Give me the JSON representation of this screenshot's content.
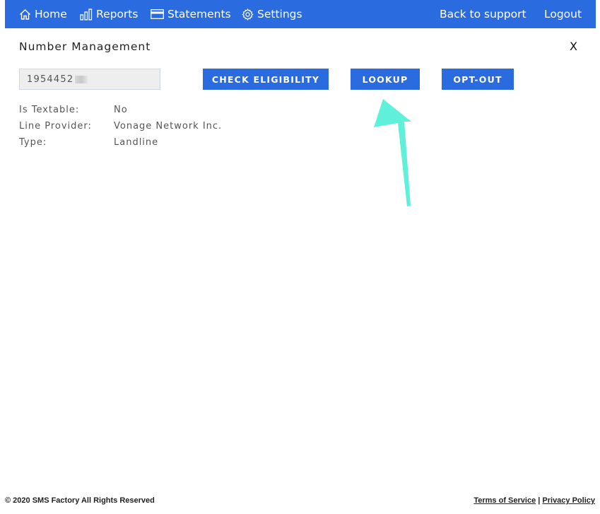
{
  "nav": {
    "home": {
      "label": "Home",
      "icon": "home-icon"
    },
    "reports": {
      "label": "Reports",
      "icon": "bar-chart-icon"
    },
    "statements": {
      "label": "Statements",
      "icon": "statement-icon"
    },
    "settings": {
      "label": "Settings",
      "icon": "gear-icon"
    },
    "back_to_support": "Back to support",
    "logout": "Logout"
  },
  "panel": {
    "title": "Number Management",
    "close_label": "X",
    "number_value": "1954452",
    "buttons": {
      "check_eligibility": "CHECK ELIGIBILITY",
      "lookup": "LOOKUP",
      "opt_out": "OPT-OUT"
    },
    "details": [
      {
        "label": "Is Textable:",
        "value": "No"
      },
      {
        "label": "Line Provider:",
        "value": "Vonage Network Inc."
      },
      {
        "label": "Type:",
        "value": "Landline"
      }
    ]
  },
  "footer": {
    "copyright": "© 2020 SMS Factory All Rights Reserved",
    "terms": "Terms of Service",
    "separator": "|",
    "privacy": "Privacy Policy"
  },
  "colors": {
    "primary": "#2b6be0",
    "annotation_arrow": "#5ef0d8"
  }
}
